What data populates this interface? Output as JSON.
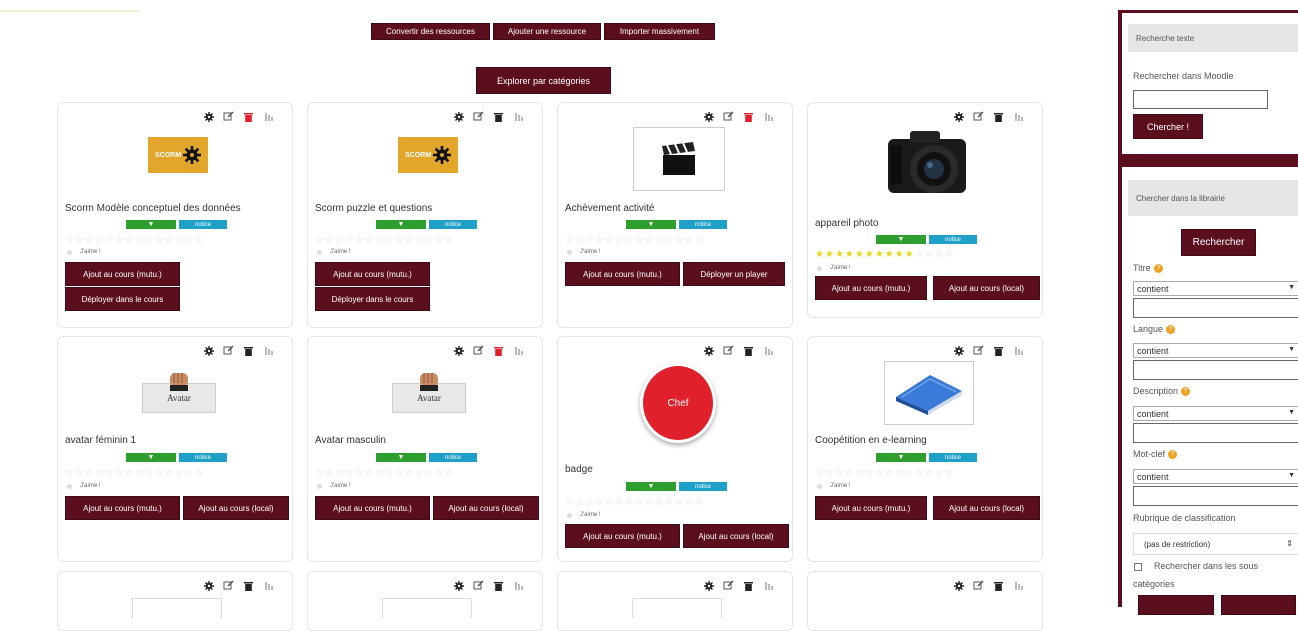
{
  "toolbar": {
    "convert_label": "Convertir des ressources",
    "add_label": "Ajouter une ressource",
    "import_label": "Importer massivement",
    "explore_label": "Explorer par catégories"
  },
  "colors": {
    "primary": "#5b0f1e",
    "notice": "#1ea0c8",
    "green": "#2e9e2e",
    "star_on": "#e6d81e"
  },
  "common": {
    "notice_label": "notice",
    "like_label": "J'aime !",
    "add_mutu": "Ajout au cours (mutu.)",
    "add_local": "Ajout au cours (local)",
    "deploy_course": "Déployer dans le cours",
    "deploy_player": "Déployer un player"
  },
  "cards": [
    {
      "title": "Scorm Modèle conceptuel des données",
      "thumb": "scorm-logo",
      "thumb_text": "SCORM",
      "rating": 0
    },
    {
      "title": "Scorm puzzle et questions",
      "thumb": "scorm-logo",
      "thumb_text": "SCORM",
      "rating": 0
    },
    {
      "title": "Achèvement activité",
      "thumb": "clapperboard-image",
      "rating": 0
    },
    {
      "title": "appareil photo",
      "thumb": "camera-image",
      "rating": 10
    },
    {
      "title": "avatar féminin 1",
      "thumb": "avatar-image",
      "thumb_text": "Avatar",
      "rating": 0
    },
    {
      "title": "Avatar masculin",
      "thumb": "avatar-image",
      "thumb_text": "Avatar",
      "rating": 0
    },
    {
      "title": "badge",
      "thumb": "chef-badge-image",
      "thumb_text": "Chef",
      "rating": 0
    },
    {
      "title": "Coopétition en e-learning",
      "thumb": "book-image",
      "rating": 0
    }
  ],
  "sidebar": {
    "text_search_header": "Recherche texte",
    "moodle_search_label": "Rechercher dans Moodle",
    "moodle_search_value": "",
    "search_button": "Chercher !",
    "library_header": "Chercher dans la librairie",
    "library_search_button": "Rechercher",
    "title_label": "Titre",
    "language_label": "Langue",
    "description_label": "Description",
    "keyword_label": "Mot-clef",
    "contains_option": "contient",
    "classification_label": "Rubrique de classification",
    "classification_value": "(pas de restriction)",
    "subcategories_line1": "Rechercher dans les sous",
    "subcategories_line2": "catégories"
  }
}
